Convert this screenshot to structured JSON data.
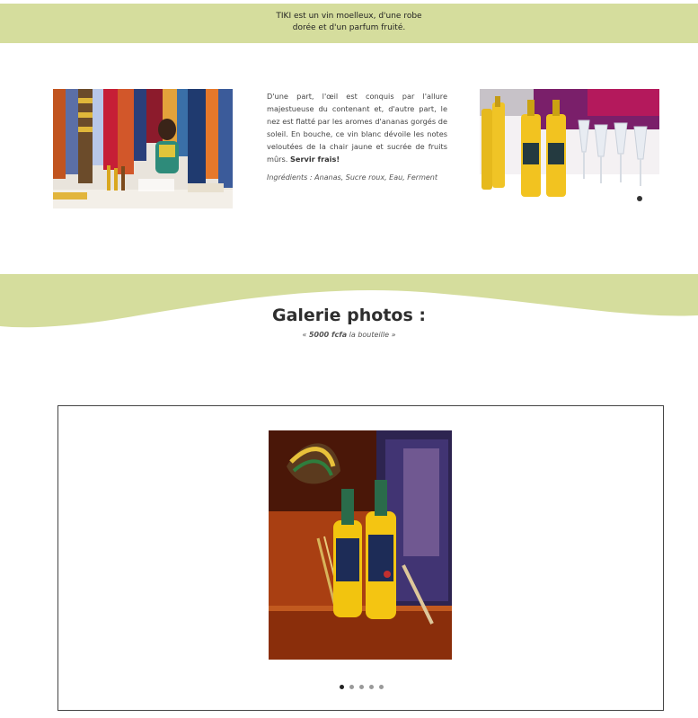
{
  "banner": {
    "line1": "TIKI est un vin moelleux, d'une robe",
    "line2": "dorée et d'un parfum fruité."
  },
  "images": {
    "left": "photo-market-stall",
    "right": "photo-bottles-and-glasses",
    "gallery": "photo-two-bottles-on-shelf"
  },
  "description": {
    "text": "D'une part, l'œil est conquis par l'allure majestueuse du contenant et, d'autre part, le nez est flatté par les aromes d'ananas gorgés de soleil. En bouche, ce vin blanc dévoile les notes veloutées de la chair jaune et sucrée de fruits mûrs.",
    "emphasis": "Servir frais!",
    "ingredients": "Ingrédients : Ananas, Sucre roux, Eau, Ferment"
  },
  "gallery": {
    "title": "Galerie photos :",
    "price_open": "« ",
    "price_amount": "5000 fcfa",
    "price_rest": " la bouteille »",
    "slide_count": 5,
    "active_slide": 1
  },
  "colors": {
    "accent": "#d5dd9d",
    "border": "#444444",
    "dot_active": "#222222",
    "dot_inactive": "#9a9a9a"
  }
}
